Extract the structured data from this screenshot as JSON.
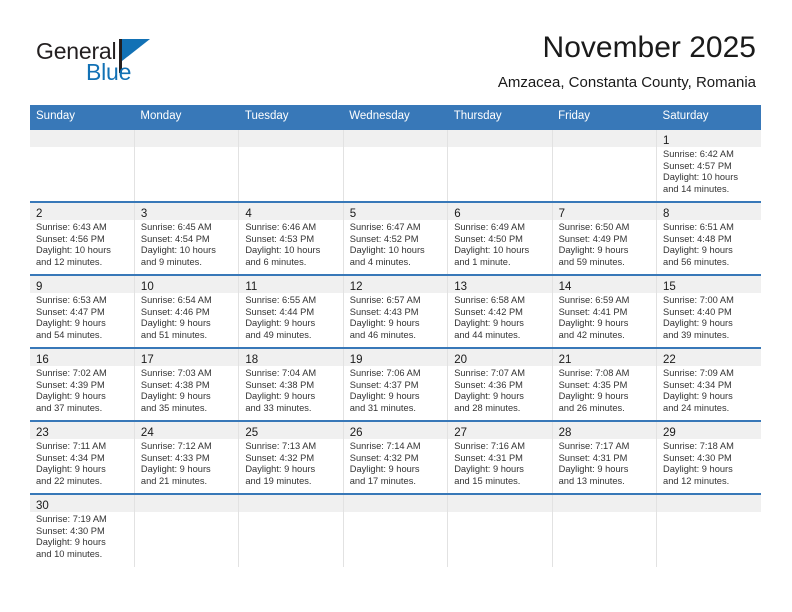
{
  "brand": {
    "name_part1": "General",
    "name_part2": "Blue",
    "accent_color": "#1271b5"
  },
  "header": {
    "month_title": "November 2025",
    "location": "Amzacea, Constanta County, Romania"
  },
  "theme": {
    "header_bg": "#3878b8",
    "daynum_band_bg": "#f0f0f0",
    "row_separator": "#3878b8",
    "text_color": "#333333"
  },
  "weekday_headers": [
    "Sunday",
    "Monday",
    "Tuesday",
    "Wednesday",
    "Thursday",
    "Friday",
    "Saturday"
  ],
  "weeks": [
    [
      {
        "day": "",
        "lines": []
      },
      {
        "day": "",
        "lines": []
      },
      {
        "day": "",
        "lines": []
      },
      {
        "day": "",
        "lines": []
      },
      {
        "day": "",
        "lines": []
      },
      {
        "day": "",
        "lines": []
      },
      {
        "day": "1",
        "lines": [
          "Sunrise: 6:42 AM",
          "Sunset: 4:57 PM",
          "Daylight: 10 hours",
          "and 14 minutes."
        ]
      }
    ],
    [
      {
        "day": "2",
        "lines": [
          "Sunrise: 6:43 AM",
          "Sunset: 4:56 PM",
          "Daylight: 10 hours",
          "and 12 minutes."
        ]
      },
      {
        "day": "3",
        "lines": [
          "Sunrise: 6:45 AM",
          "Sunset: 4:54 PM",
          "Daylight: 10 hours",
          "and 9 minutes."
        ]
      },
      {
        "day": "4",
        "lines": [
          "Sunrise: 6:46 AM",
          "Sunset: 4:53 PM",
          "Daylight: 10 hours",
          "and 6 minutes."
        ]
      },
      {
        "day": "5",
        "lines": [
          "Sunrise: 6:47 AM",
          "Sunset: 4:52 PM",
          "Daylight: 10 hours",
          "and 4 minutes."
        ]
      },
      {
        "day": "6",
        "lines": [
          "Sunrise: 6:49 AM",
          "Sunset: 4:50 PM",
          "Daylight: 10 hours",
          "and 1 minute."
        ]
      },
      {
        "day": "7",
        "lines": [
          "Sunrise: 6:50 AM",
          "Sunset: 4:49 PM",
          "Daylight: 9 hours",
          "and 59 minutes."
        ]
      },
      {
        "day": "8",
        "lines": [
          "Sunrise: 6:51 AM",
          "Sunset: 4:48 PM",
          "Daylight: 9 hours",
          "and 56 minutes."
        ]
      }
    ],
    [
      {
        "day": "9",
        "lines": [
          "Sunrise: 6:53 AM",
          "Sunset: 4:47 PM",
          "Daylight: 9 hours",
          "and 54 minutes."
        ]
      },
      {
        "day": "10",
        "lines": [
          "Sunrise: 6:54 AM",
          "Sunset: 4:46 PM",
          "Daylight: 9 hours",
          "and 51 minutes."
        ]
      },
      {
        "day": "11",
        "lines": [
          "Sunrise: 6:55 AM",
          "Sunset: 4:44 PM",
          "Daylight: 9 hours",
          "and 49 minutes."
        ]
      },
      {
        "day": "12",
        "lines": [
          "Sunrise: 6:57 AM",
          "Sunset: 4:43 PM",
          "Daylight: 9 hours",
          "and 46 minutes."
        ]
      },
      {
        "day": "13",
        "lines": [
          "Sunrise: 6:58 AM",
          "Sunset: 4:42 PM",
          "Daylight: 9 hours",
          "and 44 minutes."
        ]
      },
      {
        "day": "14",
        "lines": [
          "Sunrise: 6:59 AM",
          "Sunset: 4:41 PM",
          "Daylight: 9 hours",
          "and 42 minutes."
        ]
      },
      {
        "day": "15",
        "lines": [
          "Sunrise: 7:00 AM",
          "Sunset: 4:40 PM",
          "Daylight: 9 hours",
          "and 39 minutes."
        ]
      }
    ],
    [
      {
        "day": "16",
        "lines": [
          "Sunrise: 7:02 AM",
          "Sunset: 4:39 PM",
          "Daylight: 9 hours",
          "and 37 minutes."
        ]
      },
      {
        "day": "17",
        "lines": [
          "Sunrise: 7:03 AM",
          "Sunset: 4:38 PM",
          "Daylight: 9 hours",
          "and 35 minutes."
        ]
      },
      {
        "day": "18",
        "lines": [
          "Sunrise: 7:04 AM",
          "Sunset: 4:38 PM",
          "Daylight: 9 hours",
          "and 33 minutes."
        ]
      },
      {
        "day": "19",
        "lines": [
          "Sunrise: 7:06 AM",
          "Sunset: 4:37 PM",
          "Daylight: 9 hours",
          "and 31 minutes."
        ]
      },
      {
        "day": "20",
        "lines": [
          "Sunrise: 7:07 AM",
          "Sunset: 4:36 PM",
          "Daylight: 9 hours",
          "and 28 minutes."
        ]
      },
      {
        "day": "21",
        "lines": [
          "Sunrise: 7:08 AM",
          "Sunset: 4:35 PM",
          "Daylight: 9 hours",
          "and 26 minutes."
        ]
      },
      {
        "day": "22",
        "lines": [
          "Sunrise: 7:09 AM",
          "Sunset: 4:34 PM",
          "Daylight: 9 hours",
          "and 24 minutes."
        ]
      }
    ],
    [
      {
        "day": "23",
        "lines": [
          "Sunrise: 7:11 AM",
          "Sunset: 4:34 PM",
          "Daylight: 9 hours",
          "and 22 minutes."
        ]
      },
      {
        "day": "24",
        "lines": [
          "Sunrise: 7:12 AM",
          "Sunset: 4:33 PM",
          "Daylight: 9 hours",
          "and 21 minutes."
        ]
      },
      {
        "day": "25",
        "lines": [
          "Sunrise: 7:13 AM",
          "Sunset: 4:32 PM",
          "Daylight: 9 hours",
          "and 19 minutes."
        ]
      },
      {
        "day": "26",
        "lines": [
          "Sunrise: 7:14 AM",
          "Sunset: 4:32 PM",
          "Daylight: 9 hours",
          "and 17 minutes."
        ]
      },
      {
        "day": "27",
        "lines": [
          "Sunrise: 7:16 AM",
          "Sunset: 4:31 PM",
          "Daylight: 9 hours",
          "and 15 minutes."
        ]
      },
      {
        "day": "28",
        "lines": [
          "Sunrise: 7:17 AM",
          "Sunset: 4:31 PM",
          "Daylight: 9 hours",
          "and 13 minutes."
        ]
      },
      {
        "day": "29",
        "lines": [
          "Sunrise: 7:18 AM",
          "Sunset: 4:30 PM",
          "Daylight: 9 hours",
          "and 12 minutes."
        ]
      }
    ],
    [
      {
        "day": "30",
        "lines": [
          "Sunrise: 7:19 AM",
          "Sunset: 4:30 PM",
          "Daylight: 9 hours",
          "and 10 minutes."
        ]
      },
      {
        "day": "",
        "lines": []
      },
      {
        "day": "",
        "lines": []
      },
      {
        "day": "",
        "lines": []
      },
      {
        "day": "",
        "lines": []
      },
      {
        "day": "",
        "lines": []
      },
      {
        "day": "",
        "lines": []
      }
    ]
  ]
}
